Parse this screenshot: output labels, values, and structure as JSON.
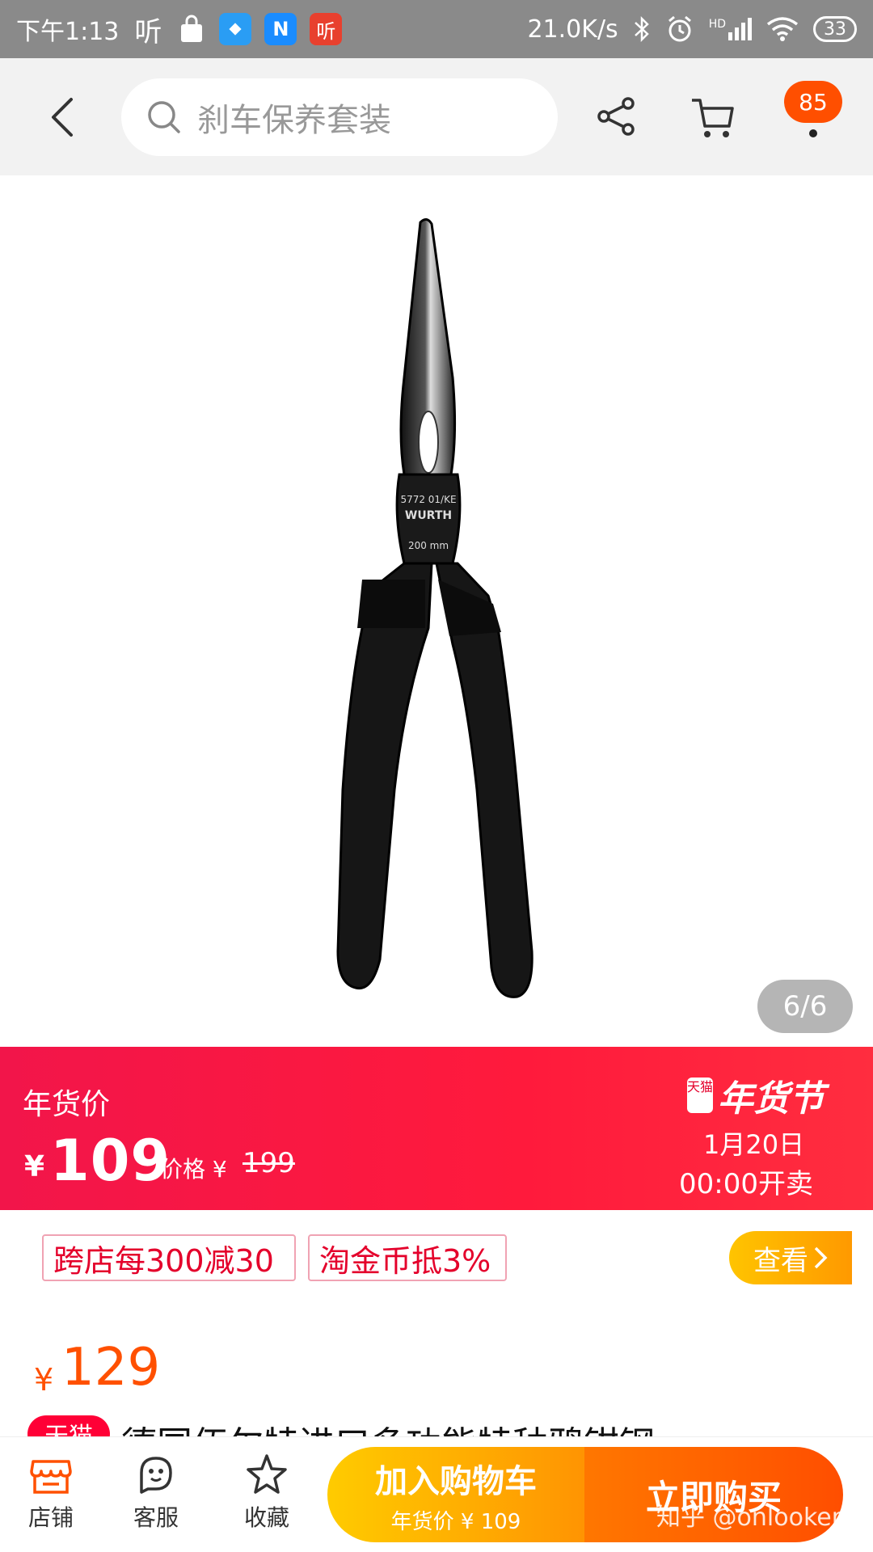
{
  "status_bar": {
    "time": "下午1:13",
    "app_glyph_1": "听",
    "app_glyph_2": "N",
    "app_glyph_3": "听",
    "network_speed": "21.0K/s",
    "hd_label": "HD",
    "battery": "33"
  },
  "search": {
    "placeholder": "刹车保养套装"
  },
  "nav": {
    "cart_badge": "85"
  },
  "gallery": {
    "indicator": "6/6",
    "product_marking_1": "5772 01/KE",
    "product_marking_2": "WURTH",
    "product_marking_3": "200 mm"
  },
  "promo_banner": {
    "label": "年货价",
    "currency": "¥",
    "price": "109",
    "original_label": "价格 ¥",
    "original_price": "199",
    "tmall_badge": "天猫",
    "festival_title": "年货节",
    "date": "1月20日",
    "time": "00:00开卖"
  },
  "coupons": {
    "items": [
      "跨店每300减30",
      "淘金币抵3%"
    ],
    "view_label": "查看"
  },
  "price": {
    "currency": "¥",
    "value": "129"
  },
  "title": {
    "tag": "天猫",
    "text": "德国伍尔特进口多功能特种鸦钳钢"
  },
  "bottom_bar": {
    "shop_label": "店铺",
    "service_label": "客服",
    "favorite_label": "收藏",
    "add_cart_label": "加入购物车",
    "add_cart_sub": "年货价 ¥ 109",
    "buy_now_label": "立即购买"
  },
  "watermark": "知乎 @onlooker",
  "colors": {
    "accent_orange": "#ff5000",
    "banner_red": "#ff1a3c",
    "coupon_red": "#e4002b",
    "cart_badge": "#ff4f00"
  },
  "icons": [
    "back-icon",
    "search-icon",
    "share-icon",
    "cart-icon",
    "shop-icon",
    "service-icon",
    "star-icon",
    "chevron-right-icon"
  ]
}
